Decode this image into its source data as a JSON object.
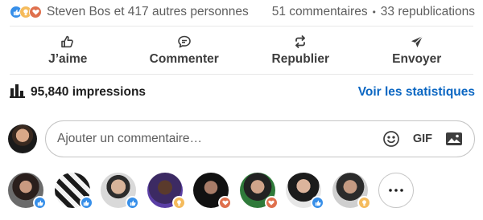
{
  "social": {
    "reactions": [
      "like",
      "insightful",
      "love"
    ],
    "summary": "Steven Bos et 417 autres personnes",
    "comments": "51 commentaires",
    "separator": "•",
    "reposts": "33 republications"
  },
  "actions": [
    {
      "label": "J’aime",
      "icon": "thumbs-up-icon"
    },
    {
      "label": "Commenter",
      "icon": "comment-icon"
    },
    {
      "label": "Republier",
      "icon": "repost-icon"
    },
    {
      "label": "Envoyer",
      "icon": "send-icon"
    }
  ],
  "impressions": {
    "icon": "bar-chart-icon",
    "text": "95,840 impressions",
    "stats_link": "Voir les statistiques"
  },
  "comment_box": {
    "placeholder": "Ajouter un commentaire…",
    "gif_label": "GIF",
    "emoji_icon": "smiley-icon",
    "image_icon": "image-icon"
  },
  "reactors": [
    {
      "reaction": "like"
    },
    {
      "reaction": "like"
    },
    {
      "reaction": "like"
    },
    {
      "reaction": "insightful"
    },
    {
      "reaction": "love"
    },
    {
      "reaction": "love"
    },
    {
      "reaction": "like"
    },
    {
      "reaction": "insightful"
    }
  ],
  "colors": {
    "like": "#378fe9",
    "insightful": "#f5bb5c",
    "love": "#df704d",
    "link": "#0a66c2"
  }
}
